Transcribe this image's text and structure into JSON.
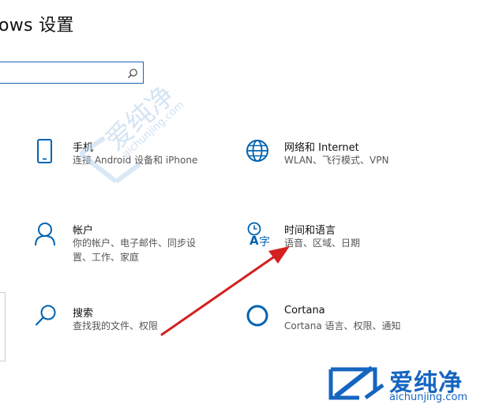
{
  "window": {
    "title": "ows 设置"
  },
  "search": {
    "placeholder": "",
    "value": ""
  },
  "tiles": [
    {
      "icon": "phone-icon",
      "title": "手机",
      "desc": "连接 Android 设备和 iPhone"
    },
    {
      "icon": "globe-icon",
      "title": "网络和 Internet",
      "desc": "WLAN、飞行模式、VPN"
    },
    {
      "icon": "person-icon",
      "title": "帐户",
      "desc": "你的帐户、电子邮件、同步设置、工作、家庭"
    },
    {
      "icon": "time-language-icon",
      "title": "时间和语言",
      "desc": "语音、区域、日期"
    },
    {
      "icon": "search-icon",
      "title": "搜索",
      "desc": "查找我的文件、权限"
    },
    {
      "icon": "cortana-icon",
      "title": "Cortana",
      "desc": "Cortana 语言、权限、通知"
    }
  ],
  "watermark": {
    "center_cn": "爱纯净",
    "center_en": "aichunjing.com",
    "logo_cn": "爱纯净",
    "logo_en": "aichunjing.com"
  },
  "colors": {
    "accent": "#0063b1",
    "annotation_arrow": "#d32020",
    "logo": "#1565c0"
  }
}
